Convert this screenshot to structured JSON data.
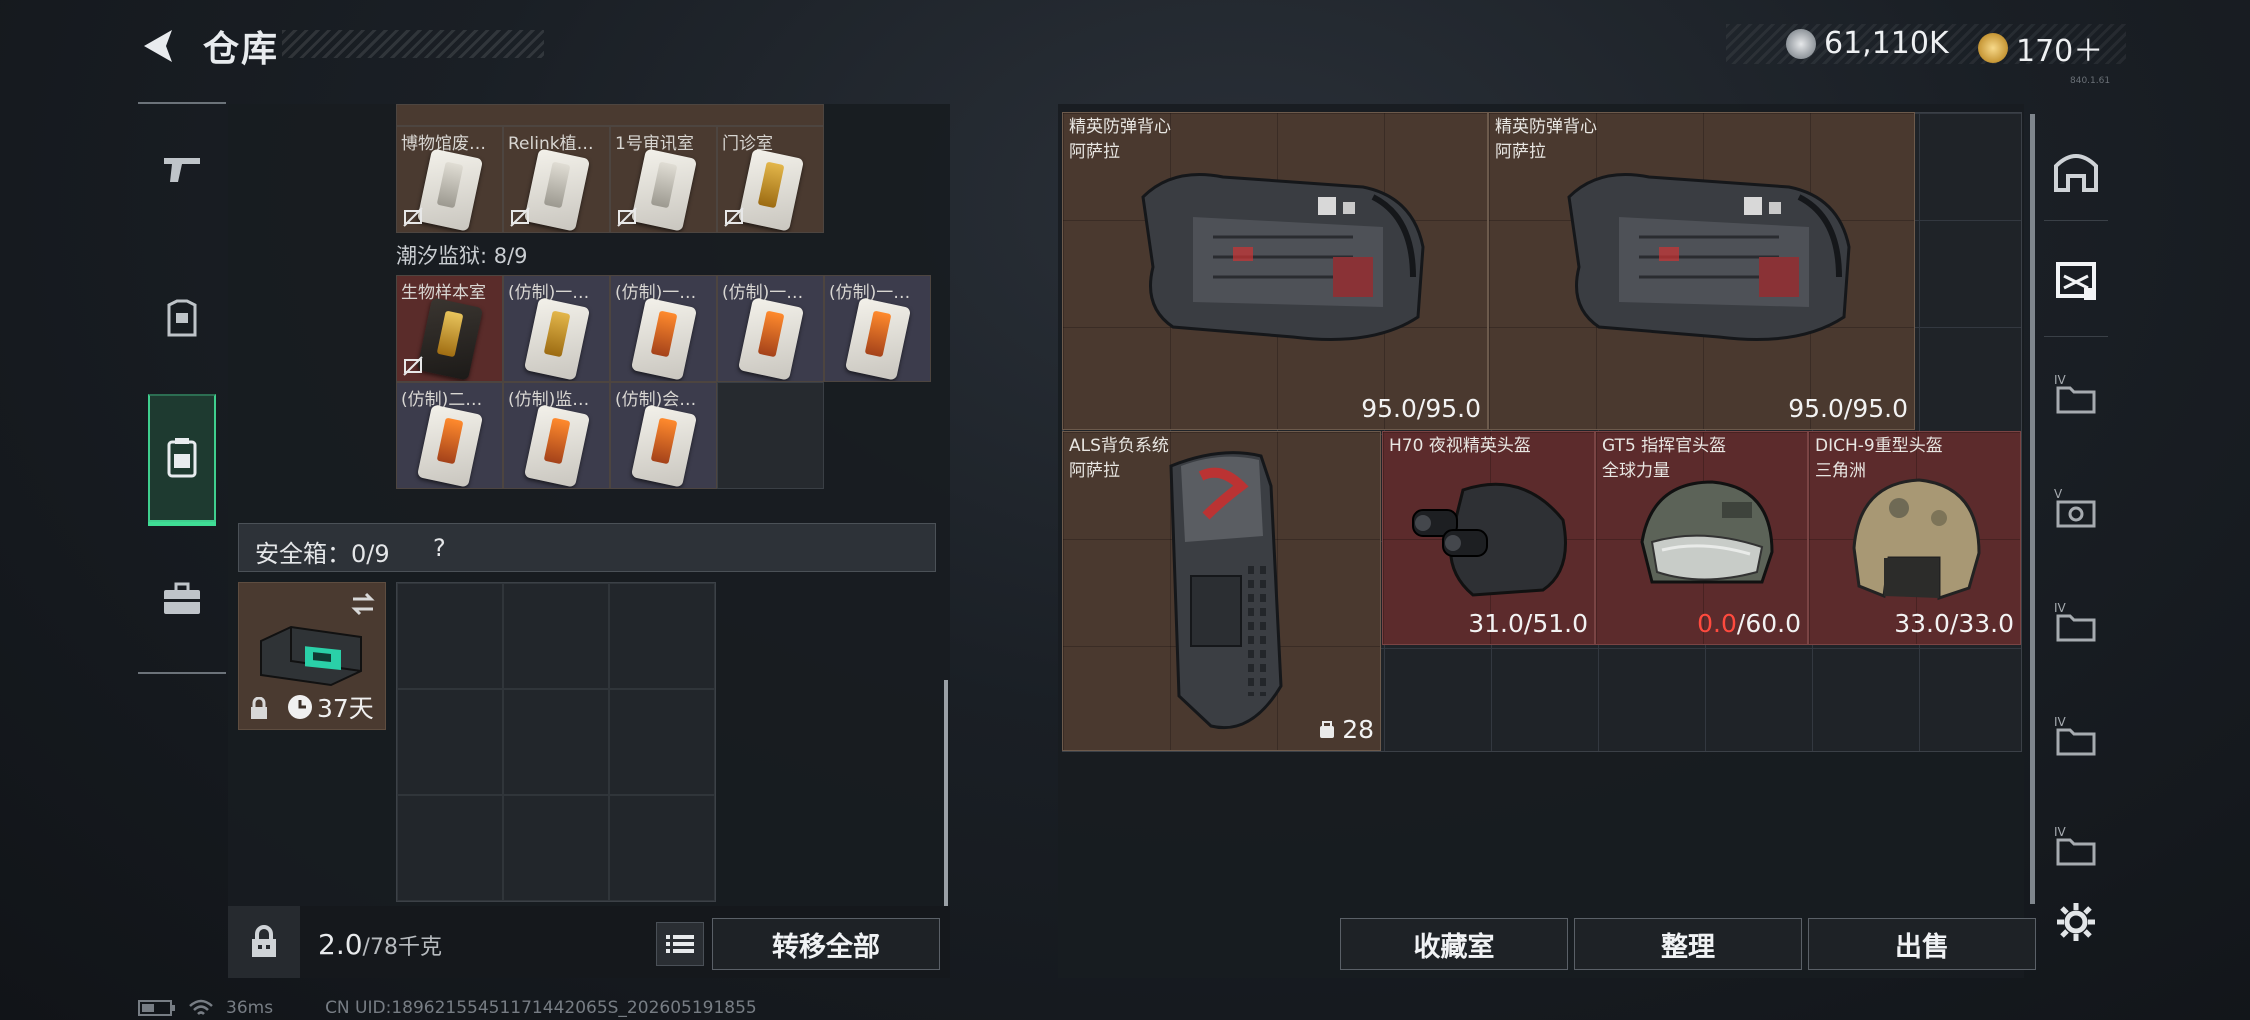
{
  "header": {
    "title": "仓库",
    "currency_silver": "61,110K",
    "currency_gold": "170＋",
    "version": "840.1.61"
  },
  "left_nav": {
    "items": [
      {
        "icon": "pistol-icon"
      },
      {
        "icon": "armor-icon"
      },
      {
        "icon": "backpack-icon"
      },
      {
        "icon": "briefcase-icon"
      }
    ],
    "active_index": 2
  },
  "keycards_top": {
    "labels": [
      "博物馆废…",
      "Relink植…",
      "1号审讯室",
      "门诊室"
    ]
  },
  "prison": {
    "title": "潮汐监狱: 8/9",
    "cards": [
      {
        "label": "生物样本室",
        "style": "red",
        "card": "black"
      },
      {
        "label": "(仿制)一…",
        "style": "purple",
        "card": "gold"
      },
      {
        "label": "(仿制)一…",
        "style": "purple",
        "card": "orange"
      },
      {
        "label": "(仿制)一…",
        "style": "purple",
        "card": "orange"
      },
      {
        "label": "(仿制)一…",
        "style": "purple",
        "card": "orange"
      },
      {
        "label": "(仿制)二…",
        "style": "purple",
        "card": "orange"
      },
      {
        "label": "(仿制)监…",
        "style": "purple",
        "card": "orange"
      },
      {
        "label": "(仿制)会…",
        "style": "purple",
        "card": "orange"
      }
    ]
  },
  "safe": {
    "label": "安全箱：0/9",
    "help": "?",
    "timer": "37天"
  },
  "bottom": {
    "weight_current": "2.0",
    "weight_max": "/78千克",
    "transfer_all": "转移全部"
  },
  "items": [
    {
      "name": "精英防弹背心",
      "sub": "阿萨拉",
      "durability": "95.0/95.0"
    },
    {
      "name": "精英防弹背心",
      "sub": "阿萨拉",
      "durability": "95.0/95.0"
    },
    {
      "name": "ALS背负系统",
      "sub": "阿萨拉",
      "count": "28"
    },
    {
      "name": "H70 夜视精英头盔",
      "sub": "",
      "durability": "31.0/51.0"
    },
    {
      "name": "GT5 指挥官头盔",
      "sub": "全球力量",
      "durability_low": "0.0",
      "durability_max": "/60.0"
    },
    {
      "name": "DICH-9重型头盔",
      "sub": "三角洲",
      "durability": "33.0/33.0"
    }
  ],
  "actions": {
    "collection": "收藏室",
    "organize": "整理",
    "sell": "出售"
  },
  "status": {
    "ping": "36ms",
    "uid": "CN UID:18962155451171442065S_202605191855"
  },
  "colors": {
    "accent_green": "#3fdd95",
    "low_durability": "#ff4a3e"
  }
}
